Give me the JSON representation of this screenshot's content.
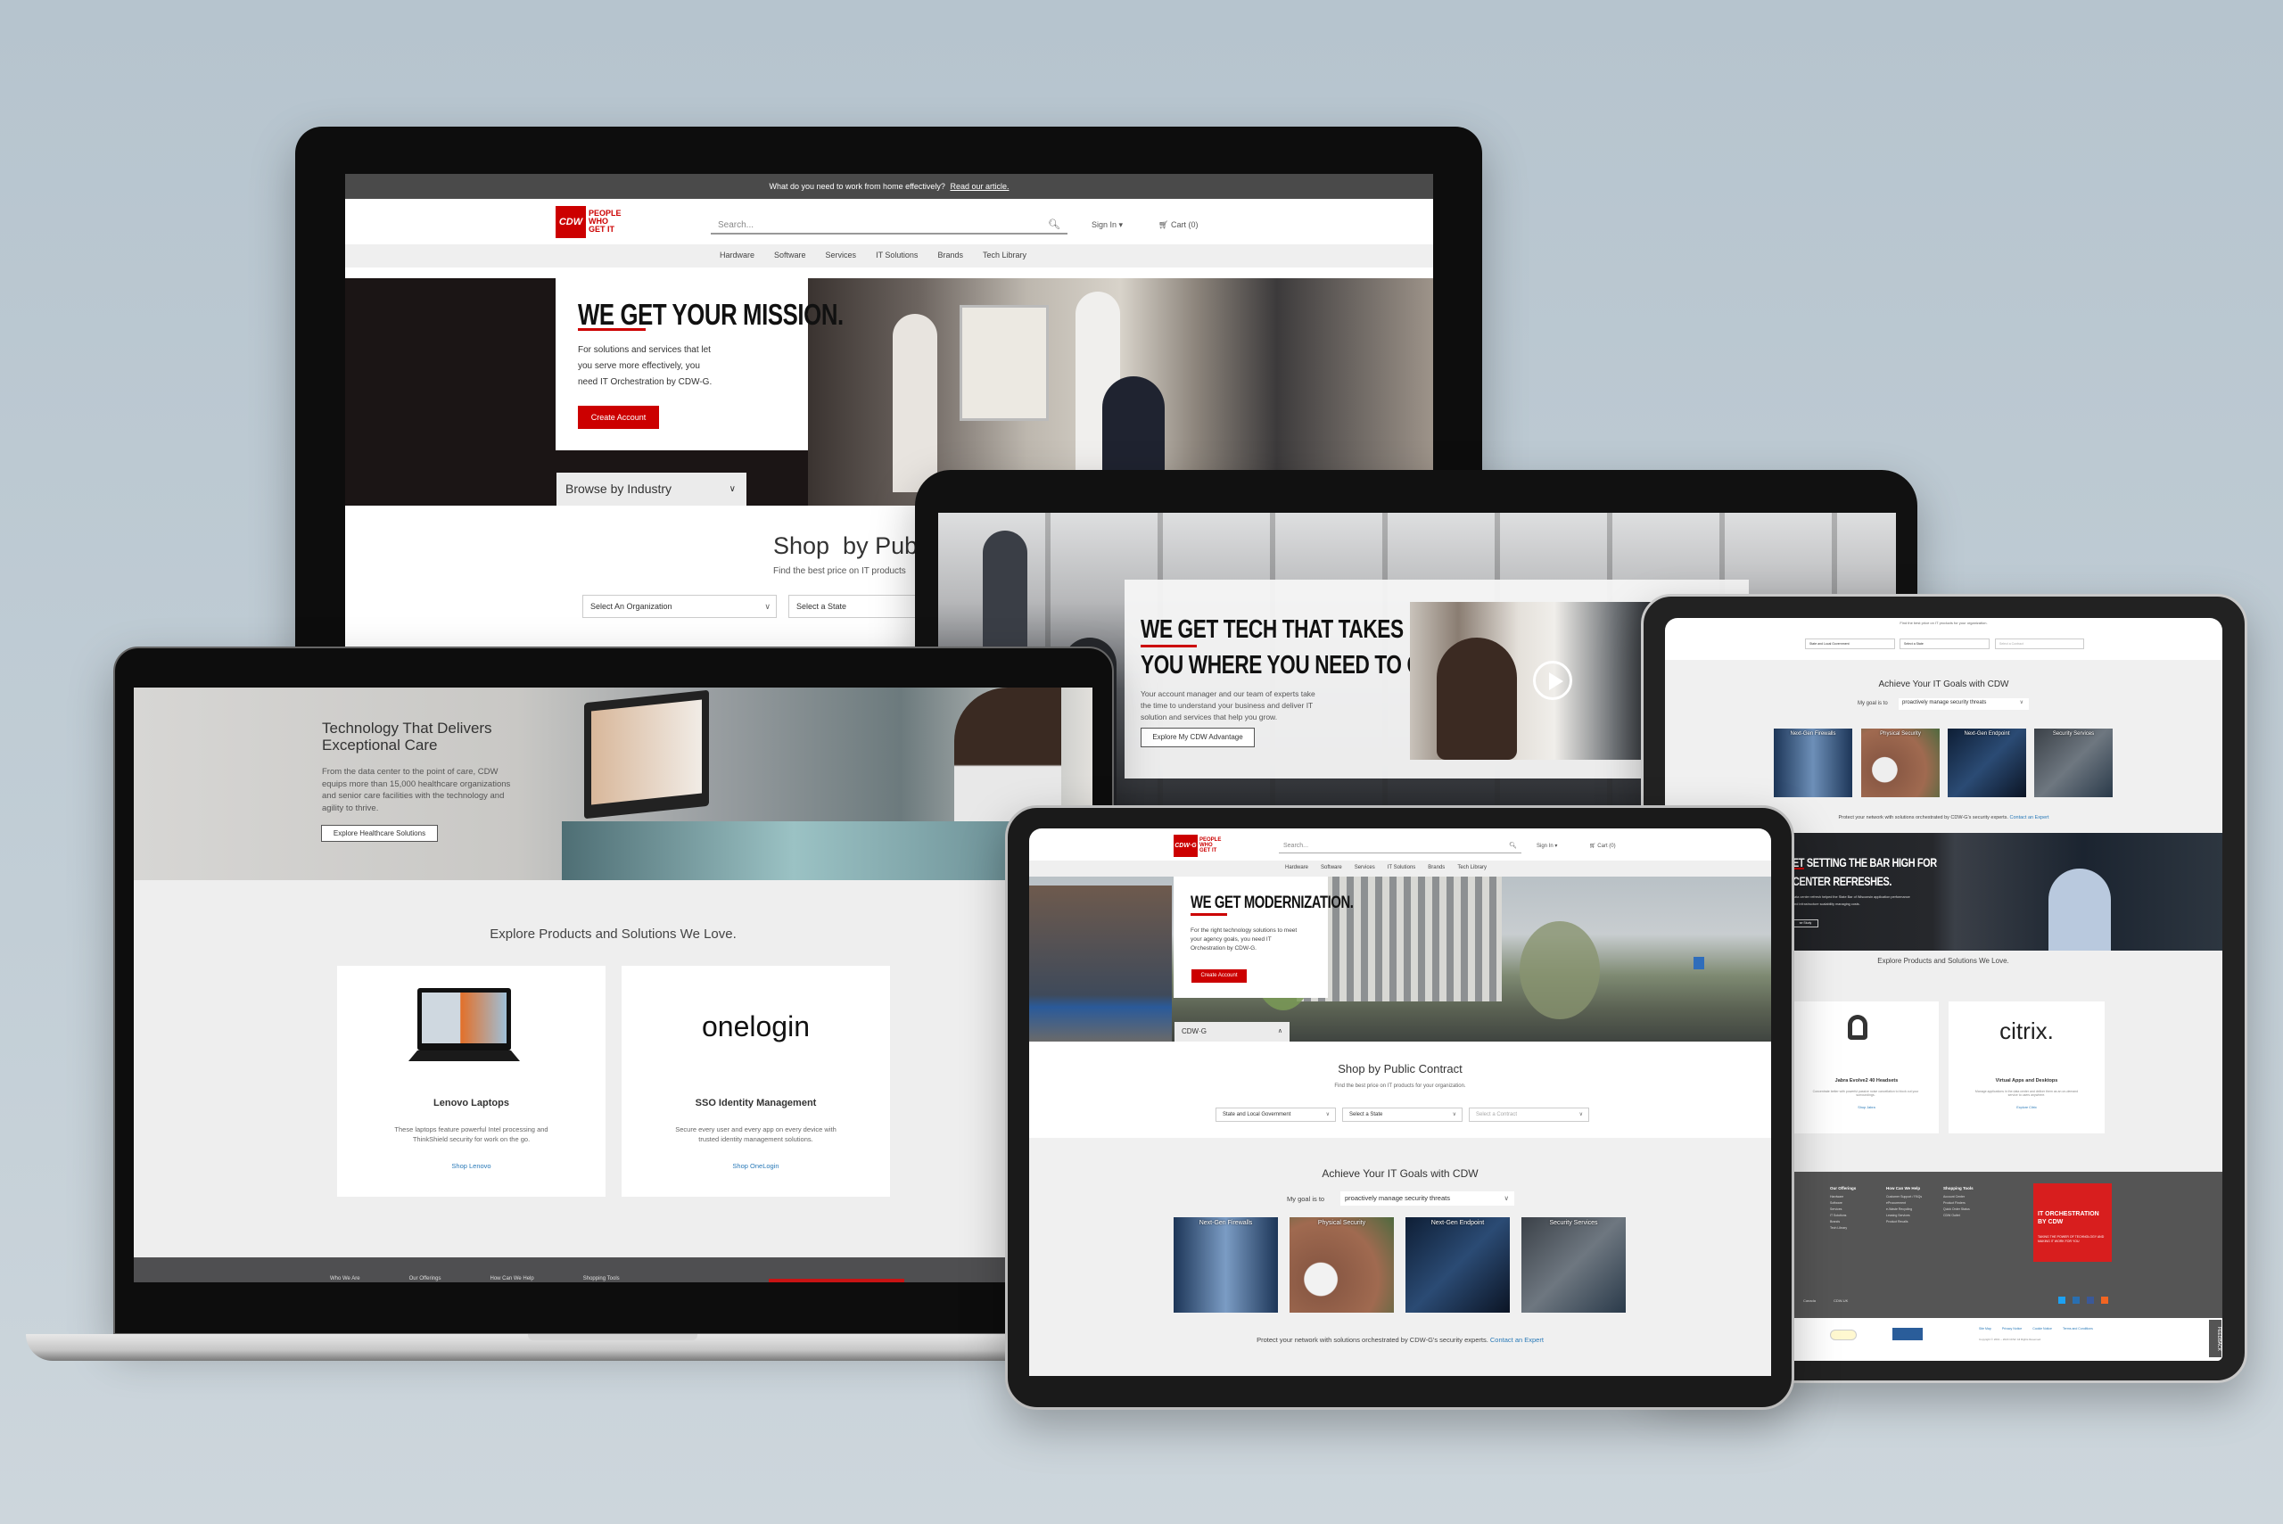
{
  "colors": {
    "brand_red": "#cc0000",
    "link_blue": "#2a7ab8",
    "promo_bar": "#4a4a4a",
    "footer_gray": "#555555"
  },
  "desktop": {
    "promo_text": "What do you need to work from home effectively?",
    "promo_link": "Read our article.",
    "logo": {
      "mark": "CDW",
      "line1": "PEOPLE",
      "line2": "WHO",
      "line3": "GET IT"
    },
    "search_placeholder": "Search...",
    "sign_in": "Sign In",
    "cart": "Cart (0)",
    "nav": [
      "Hardware",
      "Software",
      "Services",
      "IT Solutions",
      "Brands",
      "Tech Library"
    ],
    "hero": {
      "headline": "WE GET YOUR MISSION.",
      "body": "For solutions and services that let you serve more effectively, you need IT Orchestration by CDW-G.",
      "cta": "Create Account"
    },
    "industry_dropdown": "Browse by Industry",
    "shop": {
      "title": "Shop  by Public",
      "subtitle": "Find the best price on IT products",
      "selects": [
        "Select An Organization",
        "Select a State"
      ]
    }
  },
  "large_tablet": {
    "headline_1a": "WE GET",
    "headline_1b": " TECH THAT TAKES",
    "headline_2": "YOU WHERE YOU NEED TO GO.",
    "body": "Your account manager and our team of experts take the time to understand your business and deliver IT solution and services that help you grow.",
    "cta": "Explore My CDW Advantage"
  },
  "laptop": {
    "hero": {
      "title_1": "Technology That Delivers",
      "title_2": "Exceptional Care",
      "body": "From the data center to the point of care, CDW equips more than 15,000 healthcare organizations and senior care facilities with the technology and agility to thrive.",
      "cta": "Explore Healthcare Solutions"
    },
    "products": {
      "title": "Explore Products and Solutions We Love.",
      "cards": [
        {
          "title": "Lenovo Laptops",
          "desc": "These laptops feature powerful Intel processing and ThinkShield security for work on the go.",
          "link": "Shop Lenovo"
        },
        {
          "logo": "onelogin",
          "title": "SSO Identity Management",
          "desc": "Secure every user and every app on every device with trusted identity management solutions.",
          "link": "Shop OneLogin"
        }
      ]
    },
    "footer_cols": [
      "Who We Are",
      "Our Offerings",
      "How Can We Help",
      "Shopping Tools"
    ]
  },
  "front_tablet": {
    "logo": {
      "mark": "CDW·G",
      "line1": "PEOPLE",
      "line2": "WHO",
      "line3": "GET IT"
    },
    "search_placeholder": "Search...",
    "sign_in": "Sign In",
    "cart": "Cart (0)",
    "nav": [
      "Hardware",
      "Software",
      "Services",
      "IT Solutions",
      "Brands",
      "Tech Library"
    ],
    "hero": {
      "headline": "WE GET MODERNIZATION.",
      "body": "For the right technology solutions to meet your agency goals, you need IT Orchestration by CDW-G.",
      "cta": "Create Account"
    },
    "org_dropdown": "CDW·G",
    "shop": {
      "title": "Shop by Public Contract",
      "subtitle": "Find the best price on IT products for your organization.",
      "selects": [
        "State and Local Government",
        "Select a State",
        "Select a Contract"
      ]
    },
    "goals": {
      "title": "Achieve Your IT Goals with CDW",
      "label": "My goal is to",
      "goal": "proactively manage security threats",
      "tiles": [
        "Next-Gen Firewalls",
        "Physical Security",
        "Next-Gen Endpoint",
        "Security Services"
      ],
      "footer_text": "Protect your network with solutions orchestrated by CDW-G's security experts.",
      "footer_link": "Contact an Expert"
    }
  },
  "right_tablet": {
    "shop_subtitle": "Find the best price on IT products for your organization.",
    "selects": [
      "State and Local Government",
      "Select a State",
      "Select a Contract"
    ],
    "goals": {
      "title": "Achieve Your IT Goals with CDW",
      "label": "My goal is to",
      "goal": "proactively manage security threats",
      "tiles": [
        "Next-Gen Firewalls",
        "Physical Security",
        "Next-Gen Endpoint",
        "Security Services"
      ],
      "footer_text": "Protect your network with solutions orchestrated by CDW-G's security experts.",
      "footer_link": "Contact an Expert"
    },
    "case_study": {
      "line1": "ET SETTING THE BAR HIGH FOR",
      "line2": "CENTER REFRESHES.",
      "body": "data center refresh helped the State Bar of Wisconsin application performance and infrastructure scalability managing costs.",
      "cta": "se Study"
    },
    "products": {
      "title": "Explore Products and Solutions We Love.",
      "cards": [
        {
          "title": "Jabra Evolve2 40 Headsets",
          "desc": "Concentrate better with powerful passive noise cancellation to block out your surroundings.",
          "link": "Shop Jabra"
        },
        {
          "logo": "citrix.",
          "title": "Virtual Apps and Desktops",
          "desc": "Manage applications in the data center and deliver them as an on-demand service to users anywhere.",
          "link": "Explore Citrix"
        }
      ]
    },
    "footer": {
      "columns": [
        {
          "title": "Our Offerings",
          "items": [
            "Hardware",
            "Software",
            "Services",
            "IT Solutions",
            "Brands",
            "Tech Library"
          ]
        },
        {
          "title": "How Can We Help",
          "items": [
            "Customer Support / FAQs",
            "eProcurement",
            "e-Waste Recycling",
            "Leasing Services",
            "Product Recalls"
          ]
        },
        {
          "title": "Shopping Tools",
          "items": [
            "Account Center",
            "Product Finders",
            "Quick Order Status",
            "CDW Outlet"
          ]
        }
      ],
      "promo_title": "IT ORCHESTRATION BY CDW",
      "promo_sub": "TAKING THE POWER OF TECHNOLOGY AND MAKING IT WORK FOR YOU",
      "regions": [
        "CDW-G",
        "Canada",
        "CDW-UK"
      ],
      "social": [
        "twitter-icon",
        "linkedin-icon",
        "facebook-icon",
        "rss-icon"
      ],
      "legal_links": [
        "Site Map",
        "Privacy Notice",
        "Cookie Notice",
        "Terms and Conditions"
      ],
      "copyright": "Copyright © 2001 – 2020 CDW. All Rights Reserved.",
      "feedback": "FEEDBACK"
    }
  }
}
